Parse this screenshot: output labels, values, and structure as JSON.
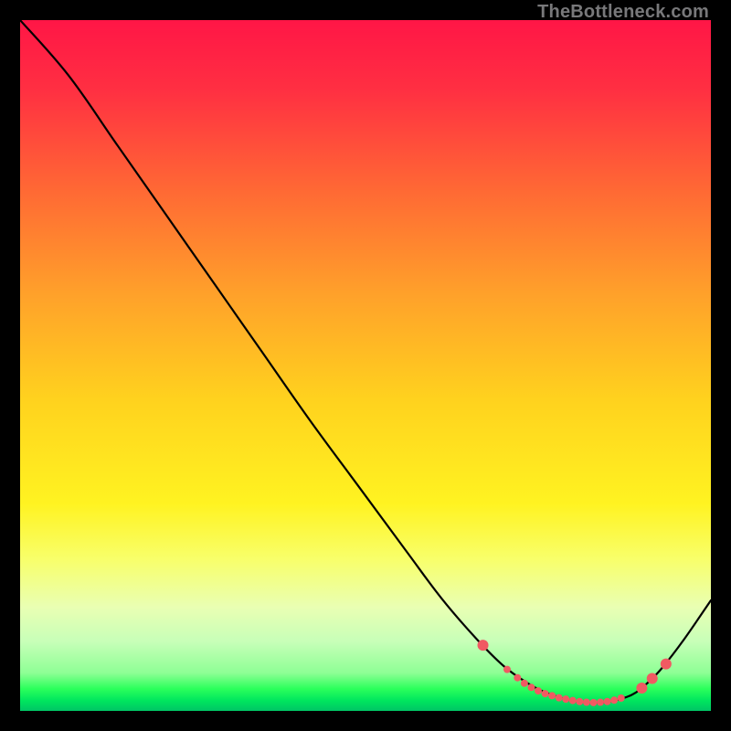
{
  "attribution": "TheBottleneck.com",
  "chart_data": {
    "type": "line",
    "title": "",
    "xlabel": "",
    "ylabel": "",
    "xlim": [
      0,
      100
    ],
    "ylim": [
      0,
      100
    ],
    "background_gradient_stops": [
      {
        "offset": 0.0,
        "color": "#ff1646"
      },
      {
        "offset": 0.1,
        "color": "#ff2f42"
      },
      {
        "offset": 0.25,
        "color": "#ff6a34"
      },
      {
        "offset": 0.4,
        "color": "#ffa22a"
      },
      {
        "offset": 0.55,
        "color": "#ffd21e"
      },
      {
        "offset": 0.7,
        "color": "#fff321"
      },
      {
        "offset": 0.78,
        "color": "#f8ff6a"
      },
      {
        "offset": 0.85,
        "color": "#e9ffb3"
      },
      {
        "offset": 0.9,
        "color": "#c7ffb8"
      },
      {
        "offset": 0.945,
        "color": "#8eff95"
      },
      {
        "offset": 0.968,
        "color": "#2bff5b"
      },
      {
        "offset": 0.985,
        "color": "#00e65e"
      },
      {
        "offset": 1.0,
        "color": "#00c565"
      }
    ],
    "series": [
      {
        "name": "bottleneck-curve",
        "color": "#000000",
        "x": [
          0.0,
          7.0,
          14.0,
          21.0,
          28.0,
          35.0,
          42.0,
          49.0,
          56.0,
          61.0,
          66.0,
          70.0,
          73.5,
          76.0,
          79.0,
          82.0,
          85.0,
          88.5,
          91.0,
          93.0,
          96.0,
          100.0
        ],
        "y": [
          100.0,
          92.0,
          82.0,
          72.0,
          62.0,
          52.0,
          42.0,
          32.5,
          23.0,
          16.3,
          10.5,
          6.5,
          4.0,
          2.7,
          1.7,
          1.2,
          1.3,
          2.3,
          4.2,
          6.3,
          10.2,
          16.0
        ]
      }
    ],
    "markers": {
      "name": "trough-markers",
      "color": "#f05a62",
      "radius_small": 4.0,
      "radius_large": 6.0,
      "points": [
        {
          "x": 67.0,
          "y": 9.5,
          "r": "large"
        },
        {
          "x": 70.5,
          "y": 6.0,
          "r": "small"
        },
        {
          "x": 72.0,
          "y": 4.8,
          "r": "small"
        },
        {
          "x": 73.0,
          "y": 4.0,
          "r": "small"
        },
        {
          "x": 74.0,
          "y": 3.4,
          "r": "small"
        },
        {
          "x": 75.0,
          "y": 2.9,
          "r": "small"
        },
        {
          "x": 76.0,
          "y": 2.5,
          "r": "small"
        },
        {
          "x": 77.0,
          "y": 2.2,
          "r": "small"
        },
        {
          "x": 78.0,
          "y": 1.9,
          "r": "small"
        },
        {
          "x": 79.0,
          "y": 1.7,
          "r": "small"
        },
        {
          "x": 80.0,
          "y": 1.5,
          "r": "small"
        },
        {
          "x": 81.0,
          "y": 1.35,
          "r": "small"
        },
        {
          "x": 82.0,
          "y": 1.25,
          "r": "small"
        },
        {
          "x": 83.0,
          "y": 1.2,
          "r": "small"
        },
        {
          "x": 84.0,
          "y": 1.25,
          "r": "small"
        },
        {
          "x": 85.0,
          "y": 1.35,
          "r": "small"
        },
        {
          "x": 86.0,
          "y": 1.55,
          "r": "small"
        },
        {
          "x": 87.0,
          "y": 1.85,
          "r": "small"
        },
        {
          "x": 90.0,
          "y": 3.3,
          "r": "large"
        },
        {
          "x": 91.5,
          "y": 4.7,
          "r": "large"
        },
        {
          "x": 93.5,
          "y": 6.8,
          "r": "large"
        }
      ]
    }
  }
}
